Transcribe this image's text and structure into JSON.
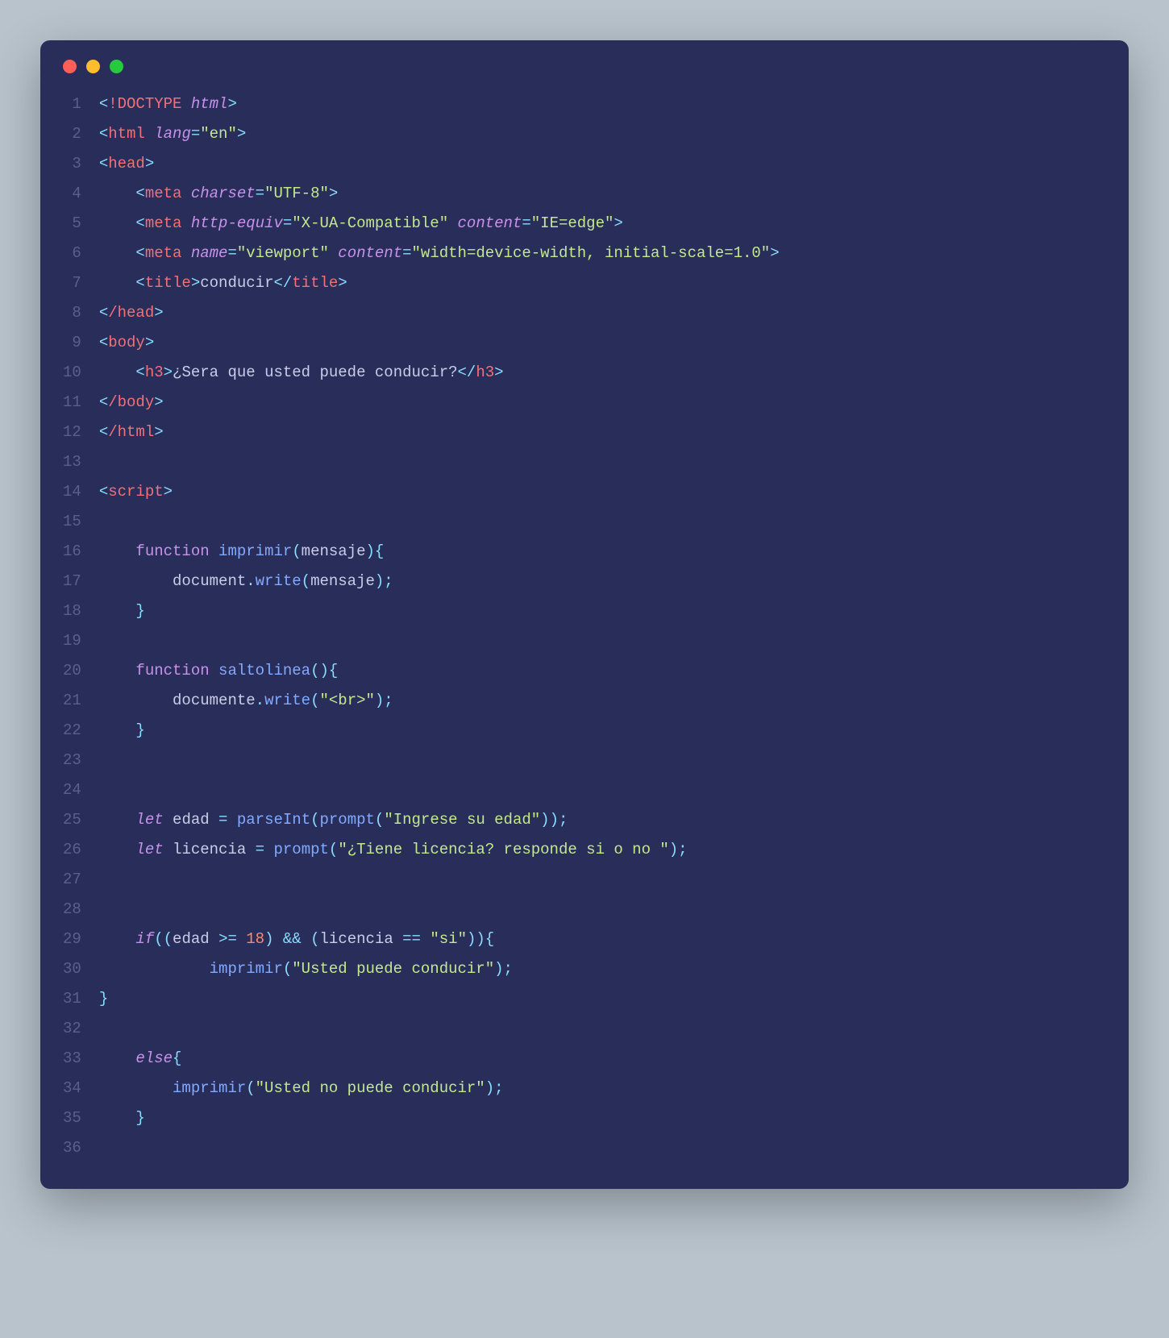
{
  "lineNumbers": [
    "1",
    "2",
    "3",
    "4",
    "5",
    "6",
    "7",
    "8",
    "9",
    "10",
    "11",
    "12",
    "13",
    "14",
    "15",
    "16",
    "17",
    "18",
    "19",
    "20",
    "21",
    "22",
    "23",
    "24",
    "25",
    "26",
    "27",
    "28",
    "29",
    "30",
    "31",
    "32",
    "33",
    "34",
    "35",
    "36"
  ],
  "code": {
    "l1": {
      "doctype": "!DOCTYPE",
      "html": "html"
    },
    "l2": {
      "tag": "html",
      "attr": "lang",
      "val": "\"en\""
    },
    "l3": {
      "tag": "head"
    },
    "l4": {
      "tag": "meta",
      "attr": "charset",
      "val": "\"UTF-8\""
    },
    "l5": {
      "tag": "meta",
      "a1": "http-equiv",
      "v1": "\"X-UA-Compatible\"",
      "a2": "content",
      "v2": "\"IE=edge\""
    },
    "l6": {
      "tag": "meta",
      "a1": "name",
      "v1": "\"viewport\"",
      "a2": "content",
      "v2": "\"width=device-width, initial-scale=1.0\""
    },
    "l7": {
      "tag": "title",
      "text": "conducir"
    },
    "l8": {
      "tag": "/head"
    },
    "l9": {
      "tag": "body"
    },
    "l10": {
      "tag": "h3",
      "text": "¿Sera que usted puede conducir?"
    },
    "l11": {
      "tag": "/body"
    },
    "l12": {
      "tag": "/html"
    },
    "l14": {
      "tag": "script"
    },
    "l16": {
      "kw": "function",
      "name": "imprimir",
      "param": "mensaje"
    },
    "l17": {
      "obj": "document",
      "method": "write",
      "arg": "mensaje"
    },
    "l18": {
      "close": "}"
    },
    "l20": {
      "kw": "function",
      "name": "saltolinea"
    },
    "l21": {
      "obj": "documente",
      "method": "write",
      "arg": "\"<br>\""
    },
    "l22": {
      "close": "}"
    },
    "l25": {
      "kw": "let",
      "var": "edad",
      "fn": "parseInt",
      "inner": "prompt",
      "str": "\"Ingrese su edad\""
    },
    "l26": {
      "kw": "let",
      "var": "licencia",
      "fn": "prompt",
      "str": "\"¿Tiene licencia? responde si o no \""
    },
    "l29": {
      "kw": "if",
      "v1": "edad",
      "op1": ">=",
      "n1": "18",
      "op2": "&&",
      "v2": "licencia",
      "op3": "==",
      "s1": "\"si\""
    },
    "l30": {
      "fn": "imprimir",
      "str": "\"Usted puede conducir\""
    },
    "l31": {
      "close": "}"
    },
    "l33": {
      "kw": "else"
    },
    "l34": {
      "fn": "imprimir",
      "str": "\"Usted no puede conducir\""
    },
    "l35": {
      "close": "}"
    }
  }
}
